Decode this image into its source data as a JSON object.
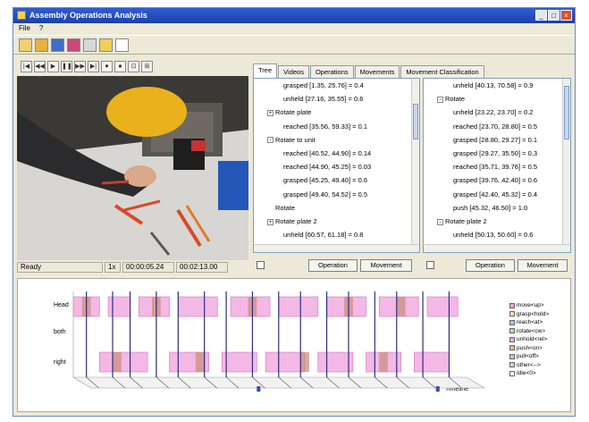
{
  "window": {
    "title": "Assembly Operations Analysis",
    "buttons": [
      "_",
      "□",
      "×"
    ]
  },
  "menu": [
    "File",
    "?"
  ],
  "toolbar": {
    "icons": [
      "new-icon",
      "open-icon",
      "save-icon",
      "export-icon",
      "settings-icon",
      "help-icon",
      "window-icon"
    ]
  },
  "video": {
    "controls": [
      "|◀",
      "◀◀",
      "▶",
      "❚❚",
      "▶▶",
      "▶|",
      "⏺",
      "⏹",
      "⊡",
      "⊞"
    ],
    "status": [
      "Ready",
      "1x",
      "00:00:05.24",
      "00:02:13.00"
    ]
  },
  "tabs": [
    "Tree",
    "Videos",
    "Operations",
    "Movements",
    "Movement Classification"
  ],
  "tree_left": [
    {
      "label": "grasped [1.35, 25.76] = 0.4",
      "depth": 3,
      "expander": ""
    },
    {
      "label": "unheld [27.16, 35.55] = 0.6",
      "depth": 3,
      "expander": ""
    },
    {
      "label": "Rotate plate",
      "depth": 1,
      "expander": "+"
    },
    {
      "label": "reached [35.56, 59.33] = 0.1",
      "depth": 3,
      "expander": ""
    },
    {
      "label": "Rotate to unit",
      "depth": 1,
      "expander": "-"
    },
    {
      "label": "reached [40.52, 44.90] = 0.14",
      "depth": 3,
      "expander": ""
    },
    {
      "label": "reached [44.90, 45.25] = 0.03",
      "depth": 3,
      "expander": ""
    },
    {
      "label": "grasped [45.25, 49.40] = 0.6",
      "depth": 3,
      "expander": ""
    },
    {
      "label": "grasped [49.40, 54.52] = 0.5",
      "depth": 3,
      "expander": ""
    },
    {
      "label": "Rotate",
      "depth": 2,
      "expander": ""
    },
    {
      "label": "Rotate plate 2",
      "depth": 1,
      "expander": "+"
    },
    {
      "label": "unheld [60.57, 61.18] = 0.8",
      "depth": 3,
      "expander": ""
    }
  ],
  "tree_right": [
    {
      "label": "unheld [40.13, 70.58] = 0.9",
      "depth": 3,
      "expander": ""
    },
    {
      "label": "Rotate",
      "depth": 1,
      "expander": "-"
    },
    {
      "label": "unheld [23.22, 23.70] = 0.2",
      "depth": 3,
      "expander": ""
    },
    {
      "label": "reached [23.70, 28.80] = 0.5",
      "depth": 3,
      "expander": ""
    },
    {
      "label": "grasped [28.80, 29.27] = 0.1",
      "depth": 3,
      "expander": ""
    },
    {
      "label": "grasped [29.27, 35.50] = 0.3",
      "depth": 3,
      "expander": ""
    },
    {
      "label": "reached [35.71, 39.76] = 0.5",
      "depth": 3,
      "expander": ""
    },
    {
      "label": "grasped [39.76, 42.40] = 0.6",
      "depth": 3,
      "expander": ""
    },
    {
      "label": "grasped [42.40, 45.32] = 0.4",
      "depth": 3,
      "expander": ""
    },
    {
      "label": "push [45.32, 46.50] = 1.0",
      "depth": 3,
      "expander": ""
    },
    {
      "label": "Rotate plate 2",
      "depth": 1,
      "expander": "-"
    },
    {
      "label": "unheld [50.13, 50.60] = 0.6",
      "depth": 3,
      "expander": ""
    }
  ],
  "panel_buttons": {
    "operation": "Operation",
    "movement": "Movement"
  },
  "timeline": {
    "rows": [
      "Head",
      "both",
      "right"
    ],
    "x_label": "Timeline",
    "colors": {
      "lane_fill": "#f4b8e6",
      "lane_stroke": "#cc77bb",
      "accent": "#c98b77",
      "marker": "#2b2f7a"
    },
    "lanes": [
      {
        "row": 0,
        "segments": [
          [
            0,
            6
          ],
          [
            8,
            13
          ],
          [
            15,
            22
          ],
          [
            24,
            33
          ],
          [
            36,
            45
          ],
          [
            47,
            56
          ],
          [
            58,
            67
          ],
          [
            70,
            79
          ],
          [
            81,
            88
          ]
        ]
      },
      {
        "row": 2,
        "segments": [
          [
            6,
            17
          ],
          [
            22,
            31
          ],
          [
            34,
            42
          ],
          [
            44,
            53
          ],
          [
            56,
            64
          ],
          [
            67,
            75
          ],
          [
            78,
            86
          ]
        ]
      }
    ],
    "accent_segments": [
      [
        2,
        4
      ],
      [
        18,
        20
      ],
      [
        40,
        42
      ],
      [
        62,
        64
      ],
      [
        74,
        76
      ],
      [
        9,
        11
      ],
      [
        28,
        30
      ],
      [
        52,
        54
      ],
      [
        70,
        72
      ]
    ],
    "markers": [
      3,
      9,
      13,
      19,
      24,
      30,
      35,
      41,
      47,
      52,
      58,
      63,
      69,
      74,
      80,
      86
    ]
  },
  "legend": [
    {
      "label": "move&lt;up&gt;",
      "color": "#f4a0c8"
    },
    {
      "label": "grasp&lt;hold&gt;",
      "color": "#f0e2a0"
    },
    {
      "label": "reach&lt;at&gt;",
      "color": "#a0c8f0"
    },
    {
      "label": "rotate&lt;cw&gt;",
      "color": "#b0e0b0"
    },
    {
      "label": "unhold&lt;rel&gt;",
      "color": "#e0b0e0"
    },
    {
      "label": "push&lt;on&gt;",
      "color": "#f0b890"
    },
    {
      "label": "pull&lt;off&gt;",
      "color": "#c0c0f0"
    },
    {
      "label": "other&lt;--&gt;",
      "color": "#d0d0d0"
    },
    {
      "label": "Idle&lt;0&gt;",
      "color": "#ffffff"
    }
  ]
}
